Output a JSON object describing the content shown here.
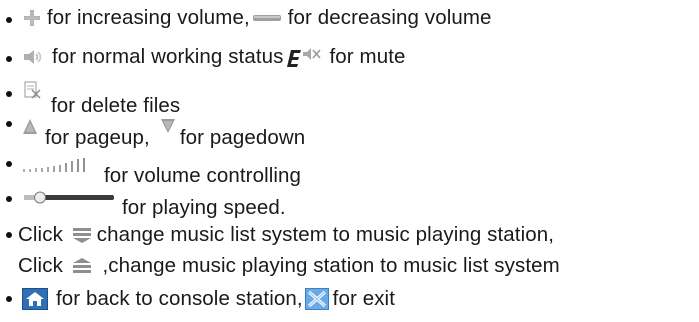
{
  "lines": [
    {
      "id": "volume",
      "segments": [
        {
          "type": "icon",
          "name": "volume-up-icon"
        },
        {
          "type": "text",
          "value": " for increasing volume, "
        },
        {
          "type": "icon",
          "name": "volume-down-icon"
        },
        {
          "type": "text",
          "value": " for decreasing volume"
        }
      ]
    },
    {
      "id": "status",
      "segments": [
        {
          "type": "icon",
          "name": "speaker-icon"
        },
        {
          "type": "text",
          "value": " for normal working status"
        },
        {
          "type": "icon",
          "name": "mute-icon"
        },
        {
          "type": "text",
          "value": " for mute"
        }
      ]
    },
    {
      "id": "delete",
      "segments": [
        {
          "type": "icon",
          "name": "delete-file-icon"
        },
        {
          "type": "text",
          "value": " for delete files"
        }
      ]
    },
    {
      "id": "paging",
      "segments": [
        {
          "type": "icon",
          "name": "pageup-icon"
        },
        {
          "type": "text",
          "value": " for pageup, "
        },
        {
          "type": "icon",
          "name": "pagedown-icon"
        },
        {
          "type": "text",
          "value": " for pagedown"
        }
      ]
    },
    {
      "id": "volume-control",
      "segments": [
        {
          "type": "icon",
          "name": "volume-bars-icon"
        },
        {
          "type": "text",
          "value": " for volume controlling"
        }
      ]
    },
    {
      "id": "speed",
      "segments": [
        {
          "type": "icon",
          "name": "speed-slider-icon"
        },
        {
          "type": "text",
          "value": " for playing speed."
        }
      ]
    },
    {
      "id": "music-list-1",
      "segments": [
        {
          "type": "text",
          "value": "Click "
        },
        {
          "type": "icon",
          "name": "down-chevron-list-icon"
        },
        {
          "type": "text",
          "value": " change music list system to music playing station,"
        }
      ]
    },
    {
      "id": "music-list-2",
      "segments": [
        {
          "type": "text",
          "value": "Click "
        },
        {
          "type": "icon",
          "name": "up-chevron-list-icon"
        },
        {
          "type": "text",
          "value": " ,change music playing station to music list system"
        }
      ]
    },
    {
      "id": "console",
      "segments": [
        {
          "type": "icon",
          "name": "home-icon"
        },
        {
          "type": "text",
          "value": " for back to console station,"
        },
        {
          "type": "icon",
          "name": "exit-icon"
        },
        {
          "type": "text",
          "value": "for exit"
        }
      ]
    }
  ],
  "colors": {
    "text": "#1a1a1a",
    "icon_gray": "#9a9a9a",
    "icon_light": "#cfcfcf",
    "icon_dark": "#555555",
    "home_blue": "#2f6fb5",
    "exit_blue": "#4a8fd8"
  }
}
